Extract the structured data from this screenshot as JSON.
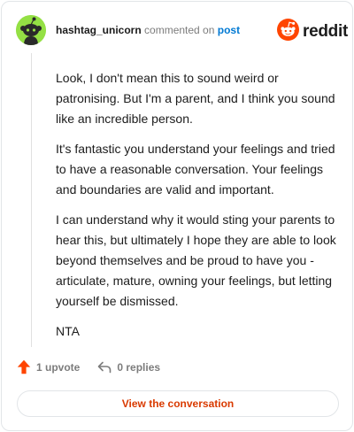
{
  "comment": {
    "username": "hashtag_unicorn",
    "commented_on_text": "commented on",
    "post_link": "post",
    "paragraphs": [
      "Look, I don't mean this to sound weird or patronising. But I'm a parent, and I think you sound like an incredible person.",
      "It's fantastic you understand your feelings and tried to have a reasonable conversation. Your feelings and boundaries are valid and important.",
      "I can understand why it would sting your parents to hear this, but ultimately I hope they are able to look beyond themselves and be proud to have you - articulate, mature, owning your feelings, but letting yourself be dismissed.",
      "NTA"
    ],
    "upvotes_label": "1 upvote",
    "replies_label": "0 replies",
    "view_button": "View the conversation"
  },
  "brand": {
    "wordmark": "reddit",
    "icon": "reddit-logo-icon",
    "accent_color": "#ff4500",
    "button_text_color": "#d93a00",
    "avatar_color": "#94e044"
  },
  "icons": {
    "upvote": "upvote-arrow-icon",
    "reply": "reply-arrow-icon",
    "avatar": "snoo-avatar-icon"
  }
}
